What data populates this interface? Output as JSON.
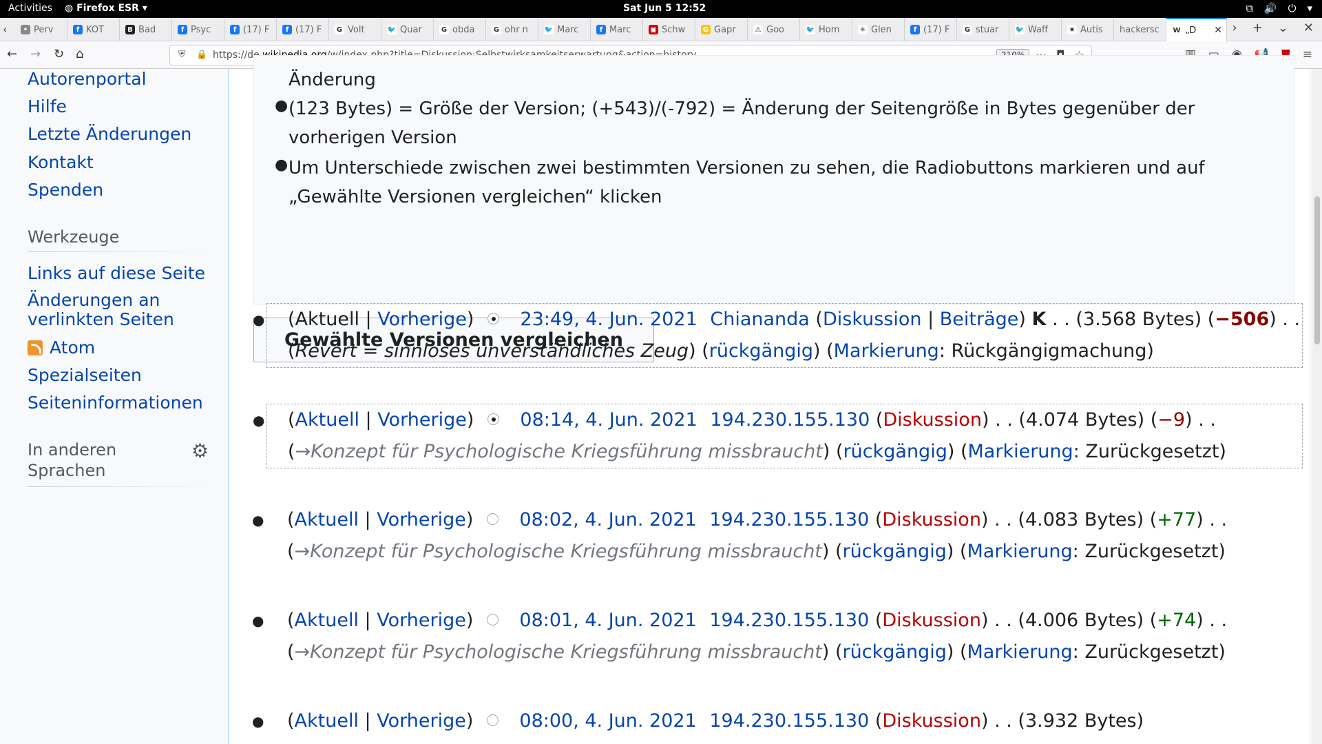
{
  "system": {
    "activities": "Activities",
    "app": "Firefox ESR",
    "clock": "Sat Jun 5  12:52"
  },
  "tabs": [
    {
      "label": "Perv",
      "icon": "generic"
    },
    {
      "label": "KOT",
      "icon": "facebook"
    },
    {
      "label": "Bad",
      "icon": "bad"
    },
    {
      "label": "Psyc",
      "icon": "facebook"
    },
    {
      "label": "(17) F",
      "icon": "facebook"
    },
    {
      "label": "(17) F",
      "icon": "facebook"
    },
    {
      "label": "Volt",
      "icon": "google"
    },
    {
      "label": "Quar",
      "icon": "twitter"
    },
    {
      "label": "obda",
      "icon": "google"
    },
    {
      "label": "ohr n",
      "icon": "google"
    },
    {
      "label": "Marc",
      "icon": "twitter"
    },
    {
      "label": "Marc",
      "icon": "facebook"
    },
    {
      "label": "Schw",
      "icon": "red"
    },
    {
      "label": "Gapr",
      "icon": "yellow"
    },
    {
      "label": "Goo",
      "icon": "warning"
    },
    {
      "label": "Hom",
      "icon": "twitter"
    },
    {
      "label": "Glen",
      "icon": "sun"
    },
    {
      "label": "(17) F",
      "icon": "facebook"
    },
    {
      "label": "stuar",
      "icon": "google"
    },
    {
      "label": "Waff",
      "icon": "twitter"
    },
    {
      "label": "Autis",
      "icon": "star"
    },
    {
      "label": "hackersc",
      "icon": "none"
    }
  ],
  "active_tab": {
    "label": "„D",
    "icon": "wikipedia"
  },
  "url": {
    "prefix": "https://de.",
    "domain": "wikipedia.org",
    "path": "/w/index.php?title=Diskussion:Selbstwirksamkeitserwartung&action=history",
    "zoom": "210%"
  },
  "sidebar": {
    "items_top": [
      "Autorenportal",
      "Hilfe",
      "Letzte Änderungen",
      "Kontakt",
      "Spenden"
    ],
    "tools_heading": "Werkzeuge",
    "tools": [
      "Links auf diese Seite",
      "Änderungen an verlinkten Seiten",
      "Atom",
      "Spezialseiten",
      "Seiteninformationen"
    ],
    "lang_heading": "In anderen Sprachen"
  },
  "legend": {
    "line1": "Änderung",
    "line2": "(123 Bytes) = Größe der Version; (+543)/(-792) = Änderung der Seitengröße in Bytes gegenüber der vorherigen Version",
    "line3": "Um Unterschiede zwischen zwei bestimmten Versionen zu sehen, die Radiobuttons markieren und auf „Gewählte Versionen vergleichen“ klicken"
  },
  "compare_button": "Gewählte Versionen vergleichen",
  "history": [
    {
      "aktuell": "Aktuell",
      "vorherige": "Vorherige",
      "date": "23:49, 4. Jun. 2021",
      "user": "Chiananda",
      "talk": "Diskussion",
      "contribs": "Beiträge",
      "minor": "K",
      "size": "3.568 Bytes",
      "diff": "−506",
      "comment": "Revert = sinnloses unverständliches Zeug",
      "undo": "rückgängig",
      "tag_label": "Markierung",
      "tag": "Rückgängigmachung"
    },
    {
      "aktuell": "Aktuell",
      "vorherige": "Vorherige",
      "date": "08:14, 4. Jun. 2021",
      "user": "194.230.155.130",
      "talk": "Diskussion",
      "size": "4.074 Bytes",
      "diff": "−9",
      "comment": "→Konzept für Psychologische Kriegsführung missbraucht",
      "undo": "rückgängig",
      "tag_label": "Markierung",
      "tag": "Zurückgesetzt"
    },
    {
      "aktuell": "Aktuell",
      "vorherige": "Vorherige",
      "date": "08:02, 4. Jun. 2021",
      "user": "194.230.155.130",
      "talk": "Diskussion",
      "size": "4.083 Bytes",
      "diff": "+77",
      "comment": "→Konzept für Psychologische Kriegsführung missbraucht",
      "undo": "rückgängig",
      "tag_label": "Markierung",
      "tag": "Zurückgesetzt"
    },
    {
      "aktuell": "Aktuell",
      "vorherige": "Vorherige",
      "date": "08:01, 4. Jun. 2021",
      "user": "194.230.155.130",
      "talk": "Diskussion",
      "size": "4.006 Bytes",
      "diff": "+74",
      "comment": "→Konzept für Psychologische Kriegsführung missbraucht",
      "undo": "rückgängig",
      "tag_label": "Markierung",
      "tag": "Zurückgesetzt"
    },
    {
      "aktuell": "Aktuell",
      "vorherige": "Vorherige",
      "date": "08:00, 4. Jun. 2021",
      "user": "194.230.155.130",
      "talk": "Diskussion",
      "size": "3.932 Bytes"
    }
  ]
}
